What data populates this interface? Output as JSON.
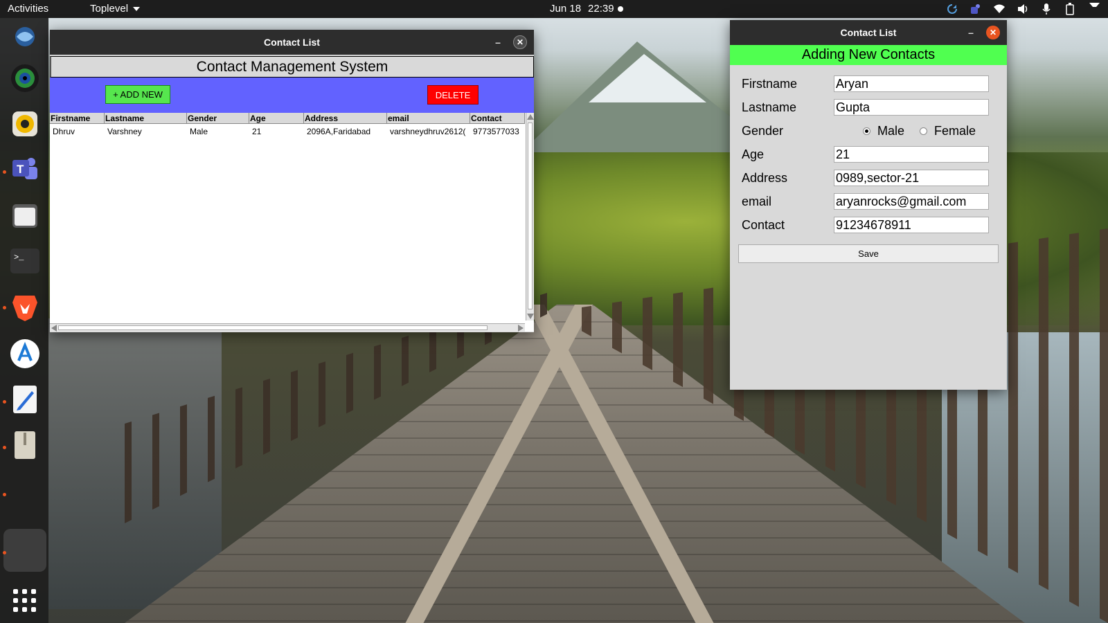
{
  "topbar": {
    "activities": "Activities",
    "app_name": "Toplevel",
    "date": "Jun 18",
    "time": "22:39"
  },
  "dock": {
    "items": [
      "app-icon",
      "webcam-icon",
      "rhythmbox-icon",
      "teams-icon",
      "files-icon",
      "terminal-icon",
      "brave-icon",
      "software-icon",
      "text-editor-icon",
      "archive-icon",
      "active-window-icon"
    ],
    "show_apps_icon": "apps-grid-icon"
  },
  "contact_list_window": {
    "title": "Contact List",
    "heading": "Contact Management System",
    "add_button": "+ ADD NEW",
    "delete_button": "DELETE",
    "columns": [
      "Firstname",
      "Lastname",
      "Gender",
      "Age",
      "Address",
      "email",
      "Contact"
    ],
    "rows": [
      [
        "Dhruv",
        "Varshney",
        "Male",
        "21",
        "2096A,Faridabad",
        "varshneydhruv2612(",
        "9773577033"
      ]
    ]
  },
  "add_contact_window": {
    "title": "Contact List",
    "heading": "Adding New Contacts",
    "labels": {
      "firstname": "Firstname",
      "lastname": "Lastname",
      "gender": "Gender",
      "age": "Age",
      "address": "Address",
      "email": "email",
      "contact": "Contact"
    },
    "values": {
      "firstname": "Aryan",
      "lastname": "Gupta",
      "age": "21",
      "address": "0989,sector-21",
      "email": "aryanrocks@gmail.com",
      "contact": "91234678911"
    },
    "gender_options": [
      "Male",
      "Female"
    ],
    "gender_selected": "Male",
    "save_button": "Save"
  },
  "colors": {
    "toolbar": "#6262ff",
    "add_button": "#56e64e",
    "delete_button": "#ff0000",
    "form_heading": "#50ff50",
    "close_accent": "#e95420"
  }
}
